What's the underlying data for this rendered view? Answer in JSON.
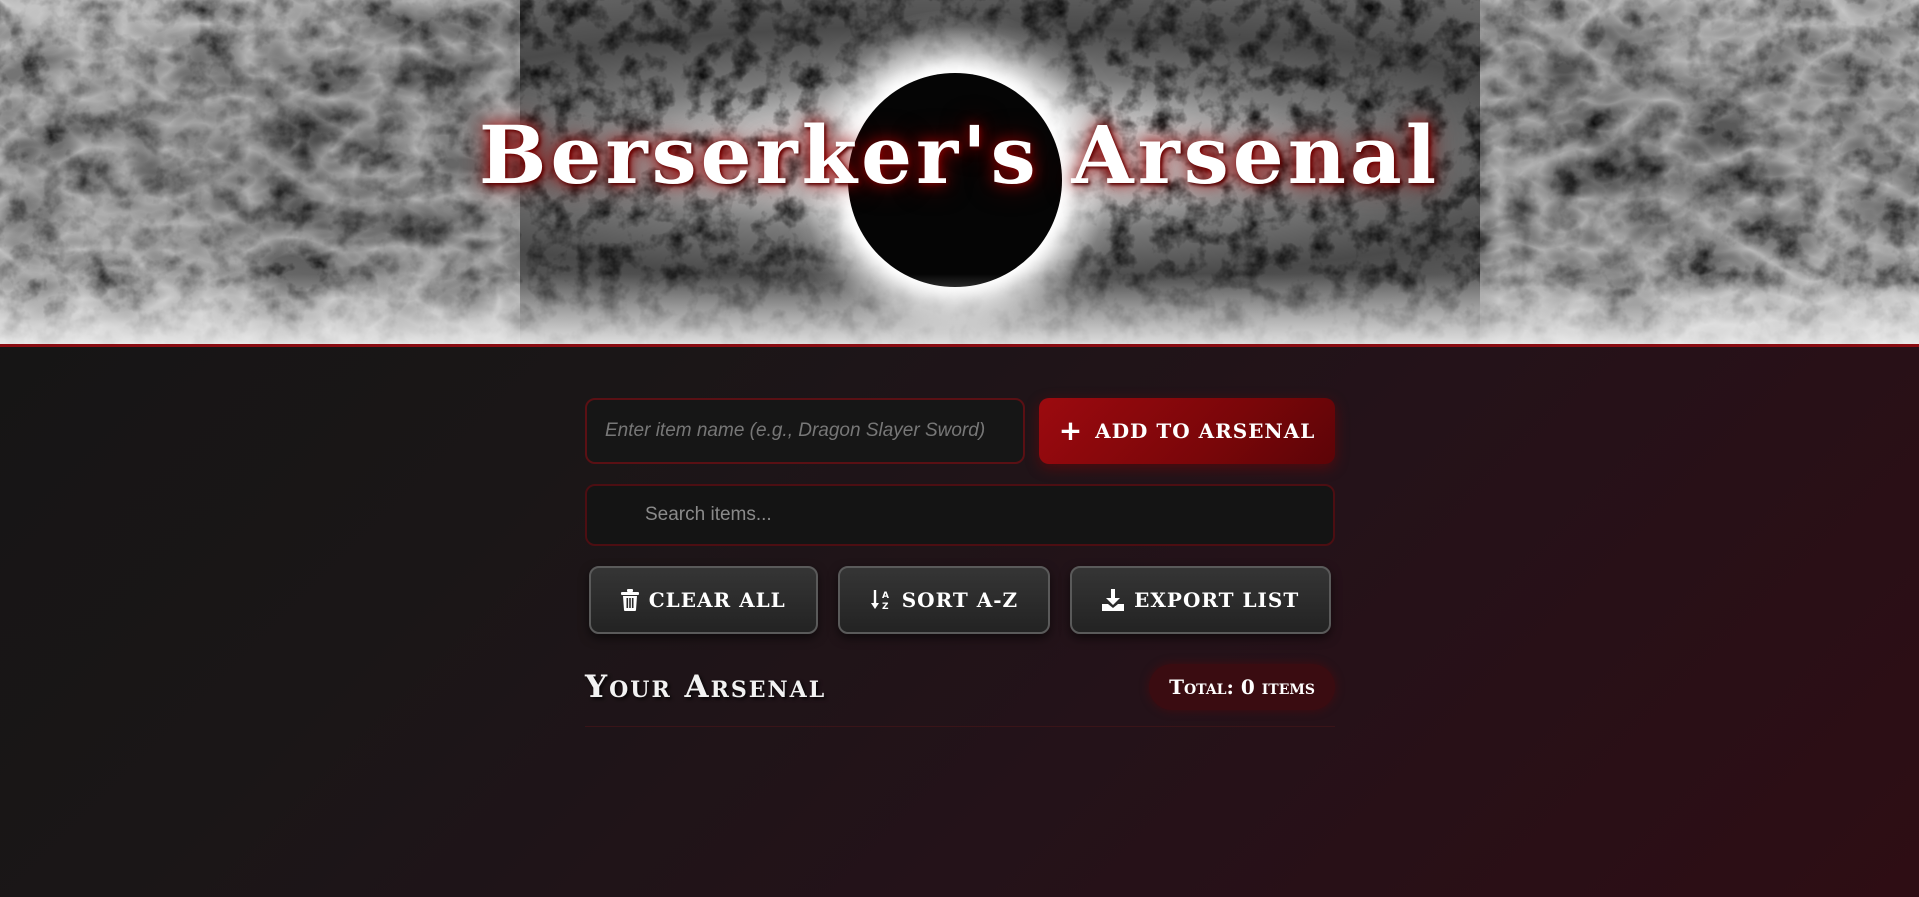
{
  "header": {
    "title": "Berserker's Arsenal"
  },
  "add_form": {
    "item_placeholder": "Enter item name (e.g., Dragon Slayer Sword)",
    "add_button_label": "ADD TO ARSENAL",
    "add_button_icon": "plus-icon"
  },
  "search": {
    "placeholder": "Search items..."
  },
  "actions": [
    {
      "label": "CLEAR ALL",
      "icon": "trash-icon"
    },
    {
      "label": "SORT A-Z",
      "icon": "sort-alpha-icon"
    },
    {
      "label": "EXPORT LIST",
      "icon": "download-icon"
    }
  ],
  "arsenal": {
    "title": "Your Arsenal",
    "total_label": "Total: 0 items"
  },
  "colors": {
    "accent_red": "#8a0c12",
    "button_red": "#9c0a0f",
    "badge_bg": "#3a0c11",
    "background": "#141414"
  }
}
